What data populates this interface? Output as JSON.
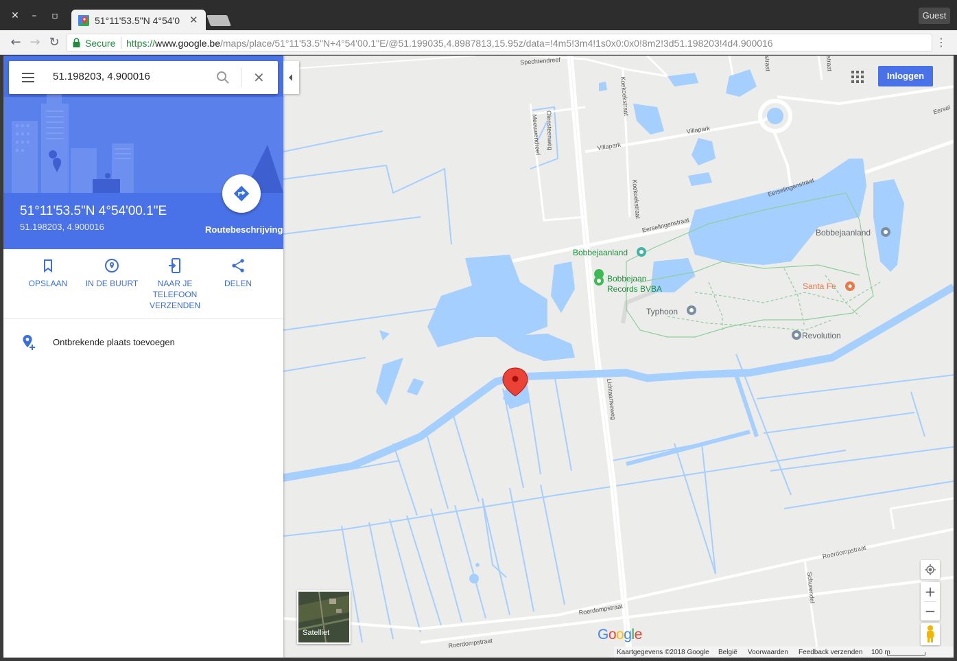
{
  "browser": {
    "tab_title": "51°11'53.5\"N 4°54'0",
    "guest_label": "Guest",
    "secure_label": "Secure",
    "url_scheme": "https://",
    "url_host": "www.google.be",
    "url_path": "/maps/place/51°11'53.5\"N+4°54'00.1\"E/@51.199035,4.8987813,15.95z/data=!4m5!3m4!1s0x0:0x0!8m2!3d51.198203!4d4.900016"
  },
  "sidebar": {
    "search_value": "51.198203, 4.900016",
    "place_title": "51°11'53.5\"N 4°54'00.1\"E",
    "place_subtitle": "51.198203, 4.900016",
    "route_label": "Routebeschrijving",
    "actions": [
      {
        "label": "OPSLAAN",
        "icon": "bookmark-icon"
      },
      {
        "label": "IN DE BUURT",
        "icon": "nearby-icon"
      },
      {
        "label": "NAAR JE TELEFOON VERZENDEN",
        "icon": "send-to-phone-icon"
      },
      {
        "label": "DELEN",
        "icon": "share-icon"
      }
    ],
    "add_place_label": "Ontbrekende plaats toevoegen"
  },
  "map": {
    "login_label": "Inloggen",
    "satellite_label": "Satelliet",
    "poi": {
      "bobbejaanland_pin": "Bobbejaanland",
      "bobbejaanland_park": "Bobbejaanland",
      "records_line1": "Bobbejaan",
      "records_line2": "Records BVBA",
      "santafe": "Santa Fe",
      "typhoon": "Typhoon",
      "revolution": "Revolution"
    },
    "roads": {
      "olensteenweg": "Olensteenweg",
      "lichtaartseweg": "Lichtaartseweg",
      "eerselingenstraat_1": "Eerselingenstraat",
      "eerselingenstraat_2": "Eerselingenstraat",
      "eersel": "Eersel",
      "villapark_1": "Villapark",
      "villapark_2": "Villapark",
      "koekoekstraat_1": "Koekoekstraat",
      "koekoekstraat_2": "Koekoekstraat",
      "meeuwendreef": "Meeuwendreef",
      "spechtendreef": "Spechtendreef",
      "roerdompstraat_1": "Roerdompstraat",
      "roerdompstraat_2": "Roerdompstraat",
      "roerdompstraat_3": "Roerdompstraat",
      "schurendel": "Schurendel",
      "straat_1": "straat",
      "straat_2": "straat"
    },
    "footer": {
      "copyright": "Kaartgegevens ©2018 Google",
      "country": "België",
      "terms": "Voorwaarden",
      "feedback": "Feedback verzenden",
      "scale": "100 m"
    },
    "colors": {
      "water": "#a5cfff",
      "park_outline": "#8fce9b",
      "marker": "#ea4335",
      "poi_green": "#1e8e3e",
      "food_orange": "#e8794a",
      "accent_blue": "#4a72e8"
    }
  }
}
